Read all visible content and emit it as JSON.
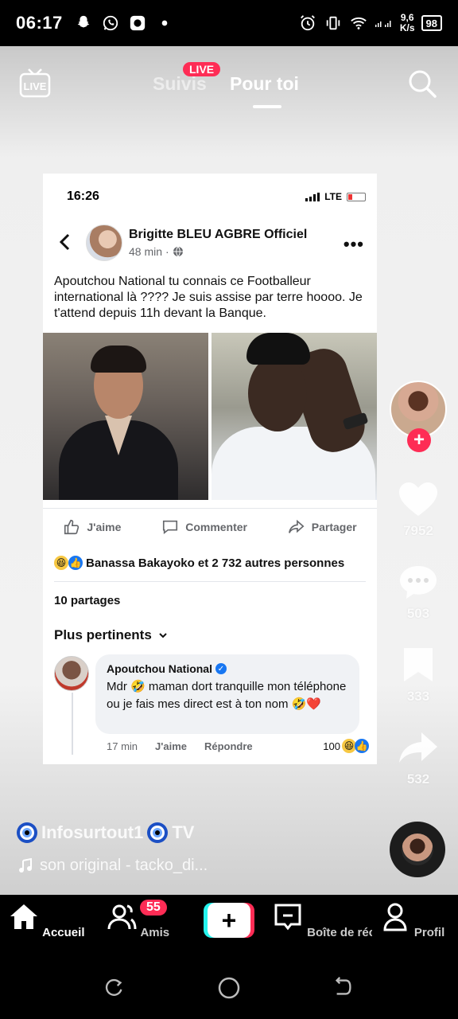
{
  "status_bar": {
    "time": "06:17",
    "net_speed_value": "9,6",
    "net_speed_unit": "K/s",
    "battery": "98"
  },
  "top_nav": {
    "tab_following": "Suivis",
    "live_badge": "LIVE",
    "tab_for_you": "Pour toi"
  },
  "post": {
    "phone_time": "16:26",
    "phone_network": "LTE",
    "author": "Brigitte BLEU AGBRE Officiel",
    "time": "48 min",
    "text": "Apoutchou National tu connais ce Footballeur international là ???? Je suis assise par terre hoooo. Je t'attend depuis 11h devant la Banque.",
    "actions": {
      "like": "J'aime",
      "comment": "Commenter",
      "share": "Partager"
    },
    "reactions_text": "Banassa Bakayoko et 2 732 autres personnes",
    "shares": "10 partages",
    "sort_label": "Plus pertinents",
    "comment": {
      "author": "Apoutchou National",
      "text": "Mdr 🤣 maman dort tranquille mon téléphone ou je fais mes direct est à ton nom 🤣❤️",
      "time": "17 min",
      "like": "J'aime",
      "reply": "Répondre",
      "count": "100"
    }
  },
  "rail": {
    "likes": "7952",
    "comments": "503",
    "saves": "333",
    "shares": "532"
  },
  "video_info": {
    "author": "Infosurtout1",
    "author_suffix": "TV",
    "sound": "son original - tacko_di..."
  },
  "bottom_nav": {
    "home": "Accueil",
    "friends": "Amis",
    "friends_badge": "55",
    "inbox": "Boîte de récepti",
    "profile": "Profil"
  },
  "colors": {
    "accent": "#fe2c55",
    "facebook_blue": "#1877f2"
  }
}
